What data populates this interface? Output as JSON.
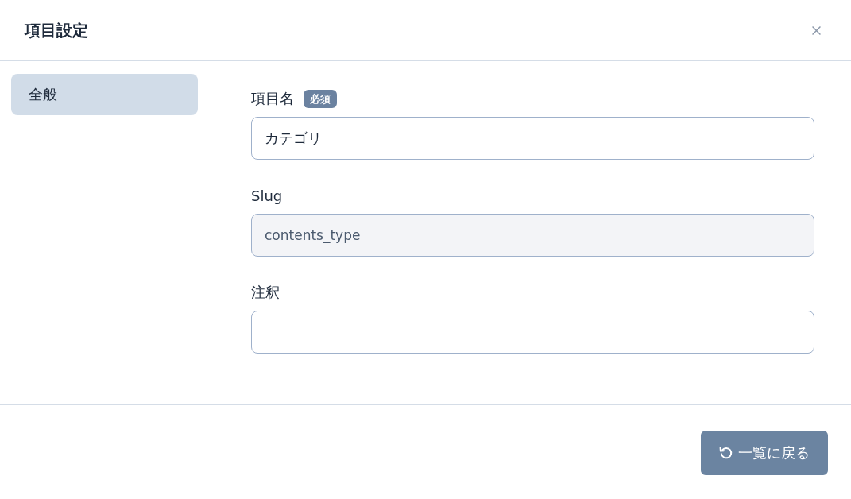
{
  "dialog": {
    "title": "項目設定"
  },
  "sidebar": {
    "items": [
      {
        "label": "全般",
        "selected": true
      }
    ]
  },
  "form": {
    "fields": [
      {
        "label": "項目名",
        "badge": "必須",
        "value": "カテゴリ",
        "disabled": false
      },
      {
        "label": "Slug",
        "value": "contents_type",
        "disabled": true
      },
      {
        "label": "注釈",
        "disabled": false
      }
    ]
  },
  "footer": {
    "buttons": [
      {
        "label": "一覧に戻る",
        "kind": "back"
      }
    ]
  }
}
